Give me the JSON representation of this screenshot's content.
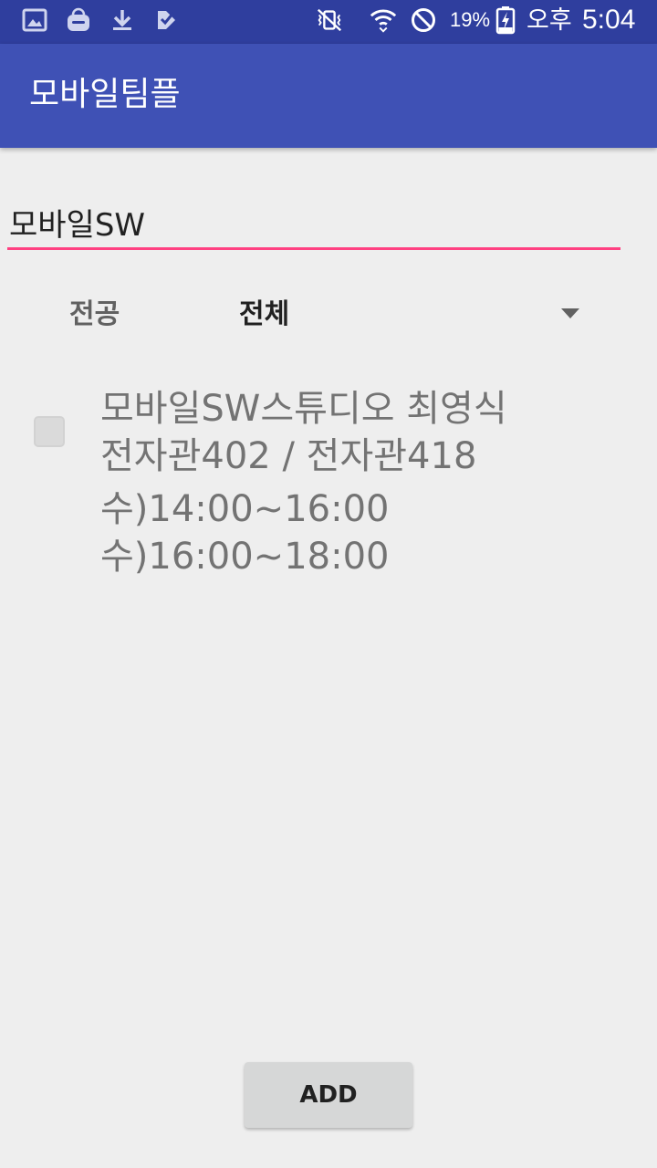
{
  "status_bar": {
    "left_icons": [
      "gallery-icon",
      "galaxy-apps-icon",
      "download-icon",
      "clipboard-check-icon"
    ],
    "right_icons": [
      "vibrate-mute-icon",
      "wifi-icon",
      "do-not-disturb-icon",
      "battery-charging-icon"
    ],
    "battery": "19%",
    "ampm": "오후",
    "time": "5:04"
  },
  "app_bar": {
    "title": "모바일팀플"
  },
  "form": {
    "title_value": "모바일SW",
    "major_label": "전공",
    "major_selected": "전체"
  },
  "courses": [
    {
      "checked": false,
      "lines": [
        "모바일SW스튜디오 최영식",
        "전자관402 / 전자관418",
        "수)14:00~16:00",
        "수)16:00~18:00"
      ]
    }
  ],
  "add_button": {
    "label": "ADD"
  },
  "colors": {
    "status_bar": "#2f3e9e",
    "app_bar": "#3f51b5",
    "accent": "#ff4081",
    "background": "#eeeeee"
  }
}
